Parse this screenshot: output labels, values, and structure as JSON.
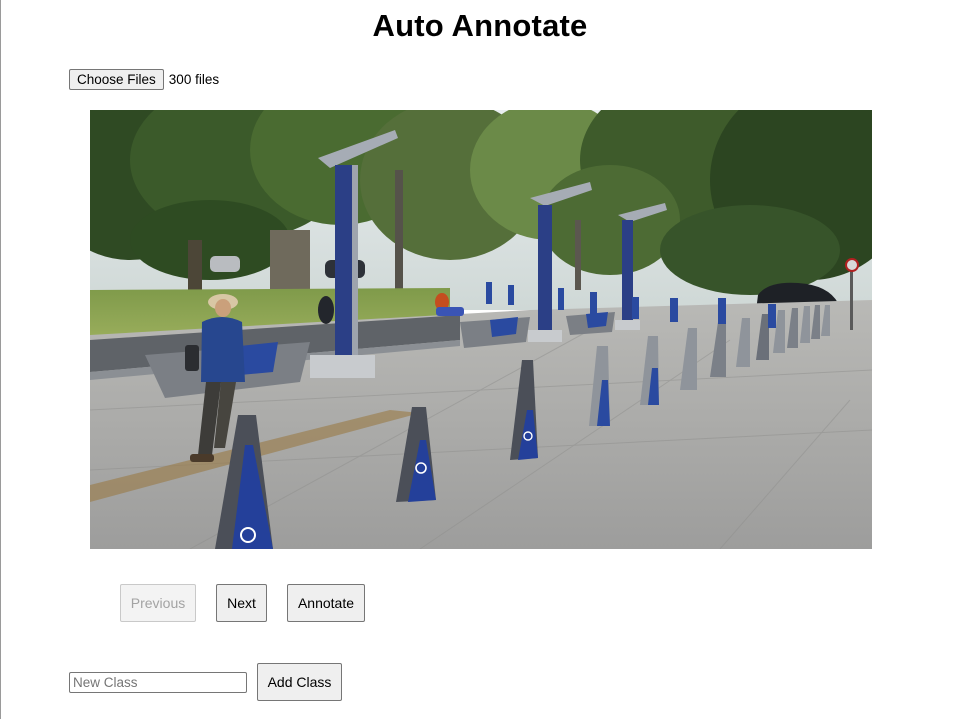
{
  "page": {
    "title": "Auto Annotate"
  },
  "file_input": {
    "button_label": "Choose Files",
    "status_text": "300 files"
  },
  "image_viewer": {
    "image_description_icon": "photo-image"
  },
  "navigation": {
    "previous_label": "Previous",
    "previous_disabled": true,
    "next_label": "Next",
    "annotate_label": "Annotate"
  },
  "class_form": {
    "input_placeholder": "New Class",
    "input_value": "",
    "add_label": "Add Class"
  },
  "colors": {
    "button_bg": "#efefef",
    "button_border": "#767676",
    "disabled_text": "#a3a3a3",
    "bollard_blue": "#24409a",
    "bollard_grey": "#4b4f58"
  }
}
